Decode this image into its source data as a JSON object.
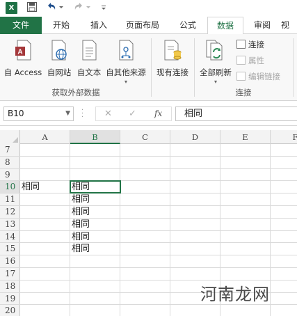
{
  "qat": {
    "app_icon_text": "X",
    "icons": [
      "save-icon",
      "undo-icon",
      "redo-icon",
      "customize-qat-icon"
    ]
  },
  "tabs": [
    {
      "label": "文件",
      "kind": "file"
    },
    {
      "label": "开始"
    },
    {
      "label": "插入"
    },
    {
      "label": "页面布局"
    },
    {
      "label": "公式"
    },
    {
      "label": "数据",
      "active": true
    },
    {
      "label": "审阅"
    },
    {
      "label": "视"
    }
  ],
  "ribbon": {
    "external_data": {
      "buttons": [
        "自 Access",
        "自网站",
        "自文本",
        "自其他来源"
      ],
      "group_label": "获取外部数据"
    },
    "existing_connections": "现有连接",
    "connections": {
      "refresh_all": "全部刷新",
      "connections": "连接",
      "properties": "属性",
      "edit_links": "编辑链接",
      "group_label": "连接"
    }
  },
  "formula_bar": {
    "name_box": "B10",
    "fx_label": "fx",
    "content": "相同"
  },
  "grid": {
    "columns": [
      "A",
      "B",
      "C",
      "D",
      "E",
      "F"
    ],
    "selected_column": "B",
    "rows": [
      {
        "num": "7",
        "a": "",
        "b": ""
      },
      {
        "num": "8",
        "a": "",
        "b": ""
      },
      {
        "num": "9",
        "a": "",
        "b": ""
      },
      {
        "num": "10",
        "a": "相同",
        "b": "相同"
      },
      {
        "num": "11",
        "a": "",
        "b": "相同"
      },
      {
        "num": "12",
        "a": "",
        "b": "相同"
      },
      {
        "num": "13",
        "a": "",
        "b": "相同"
      },
      {
        "num": "14",
        "a": "",
        "b": "相同"
      },
      {
        "num": "15",
        "a": "",
        "b": "相同"
      },
      {
        "num": "16",
        "a": "",
        "b": ""
      },
      {
        "num": "17",
        "a": "",
        "b": ""
      },
      {
        "num": "18",
        "a": "",
        "b": ""
      },
      {
        "num": "19",
        "a": "",
        "b": ""
      },
      {
        "num": "20",
        "a": "",
        "b": ""
      }
    ],
    "active_row": "10"
  },
  "watermark": "河南龙网",
  "colors": {
    "accent": "#217346",
    "ribbon_bg": "#f8f8f8"
  }
}
